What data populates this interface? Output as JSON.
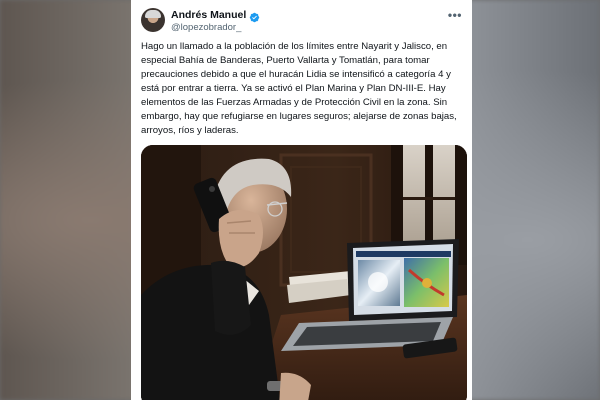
{
  "tweet": {
    "author": {
      "display_name": "Andrés Manuel",
      "handle": "@lopezobrador_",
      "verified": true,
      "avatar_icon": "profile-photo"
    },
    "more_icon": "more-horizontal-icon",
    "text": "Hago un llamado a la población de los límites entre Nayarit y Jalisco, en especial Bahía de Banderas, Puerto Vallarta y Tomatlán, para tomar precauciones debido a que el huracán Lidia se intensificó a categoría 4 y está por entrar a tierra. Ya se activó el Plan Marina y Plan DN-III-E. Hay elementos de las Fuerzas Armadas y de Protección Civil en la zona. Sin embargo, hay que refugiarse en lugares seguros; alejarse de zonas bajas, arroyos, ríos y laderas.",
    "media": {
      "type": "photo",
      "scene": "man-on-phone-with-laptop-showing-weather-radar"
    }
  },
  "colors": {
    "card_background": "#ffffff",
    "text_primary": "#0f1419",
    "text_secondary": "#536471",
    "verified_blue": "#1d9bf0"
  }
}
